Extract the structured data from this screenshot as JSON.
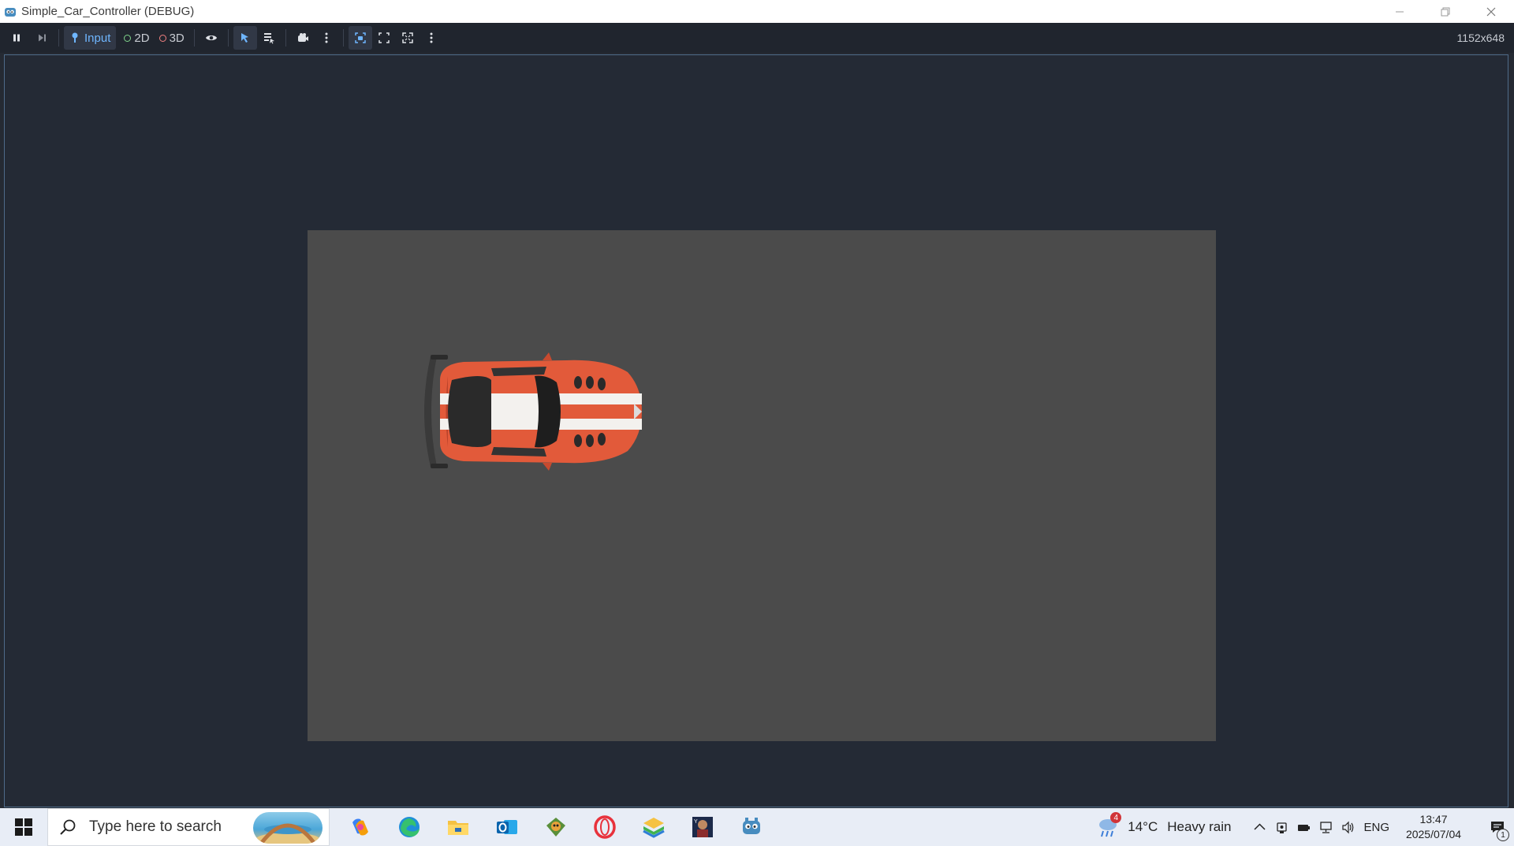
{
  "window": {
    "title": "Simple_Car_Controller (DEBUG)",
    "controls": [
      "minimize-icon",
      "restore-icon",
      "close-icon"
    ]
  },
  "toolbar": {
    "buttons": [
      {
        "name": "pause-icon"
      },
      {
        "name": "next-frame-icon"
      },
      {
        "name": "input",
        "label": "Input",
        "active": true
      },
      {
        "name": "2d",
        "label": "2D"
      },
      {
        "name": "3d",
        "label": "3D"
      },
      {
        "name": "eye-icon"
      },
      {
        "name": "select-arrow-icon",
        "active": true
      },
      {
        "name": "list-select-icon"
      },
      {
        "name": "camera-override-icon"
      },
      {
        "name": "more-icon"
      },
      {
        "name": "camera-lock-icon",
        "active": true
      },
      {
        "name": "fit-screen-icon"
      },
      {
        "name": "expand-icon"
      },
      {
        "name": "more-icon-2"
      }
    ],
    "resolution": "1152x648"
  },
  "game": {
    "background_color": "#4b4b4b",
    "sprite": "red-sports-car"
  },
  "taskbar": {
    "search_placeholder": "Type here to search",
    "pinned_apps": [
      "copilot-icon",
      "edge-icon",
      "file-explorer-icon",
      "outlook-icon",
      "game-app-icon",
      "opera-icon",
      "bluestacks-icon",
      "media-app-icon",
      "godot-icon"
    ],
    "weather": {
      "temp": "14°C",
      "condition": "Heavy rain",
      "badge": "4"
    },
    "tray_icons": [
      "chevron-up-icon",
      "usb-icon",
      "battery-icon",
      "network-icon",
      "volume-icon"
    ],
    "language": "ENG",
    "time": "13:47",
    "date": "2025/07/04",
    "notifications": "1"
  },
  "colors": {
    "accent": "#6fb6ff",
    "toolbar_bg": "#20252e",
    "viewport_bg": "#242a35",
    "viewport_border": "#4f6b89"
  }
}
